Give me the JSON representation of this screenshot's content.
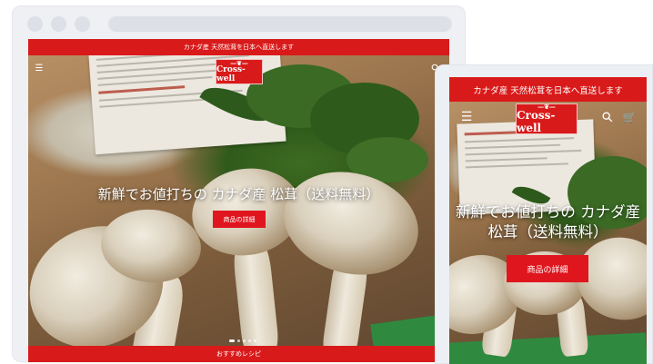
{
  "desktop": {
    "announcement": "カナダ産 天然松茸を日本へ直送します",
    "logo": {
      "name": "Cross-well",
      "mark": "—❦—"
    },
    "hero_title": "新鮮でお値打ちの カナダ産 松茸（送料無料）",
    "hero_button": "商品の詳細",
    "bottom_bar": "おすすめレシピ",
    "menu_icon": "☰",
    "search_icon": "⚲"
  },
  "mobile": {
    "announcement": "カナダ産 天然松茸を日本へ直送します",
    "logo": {
      "name": "Cross-well",
      "mark": "—❦—"
    },
    "hero_title": "新鮮でお値打ちの カナダ産 松茸（送料無料）",
    "hero_button": "商品の詳細",
    "menu_icon": "☰",
    "search_icon": "⚲",
    "cart_icon": "🛒"
  }
}
